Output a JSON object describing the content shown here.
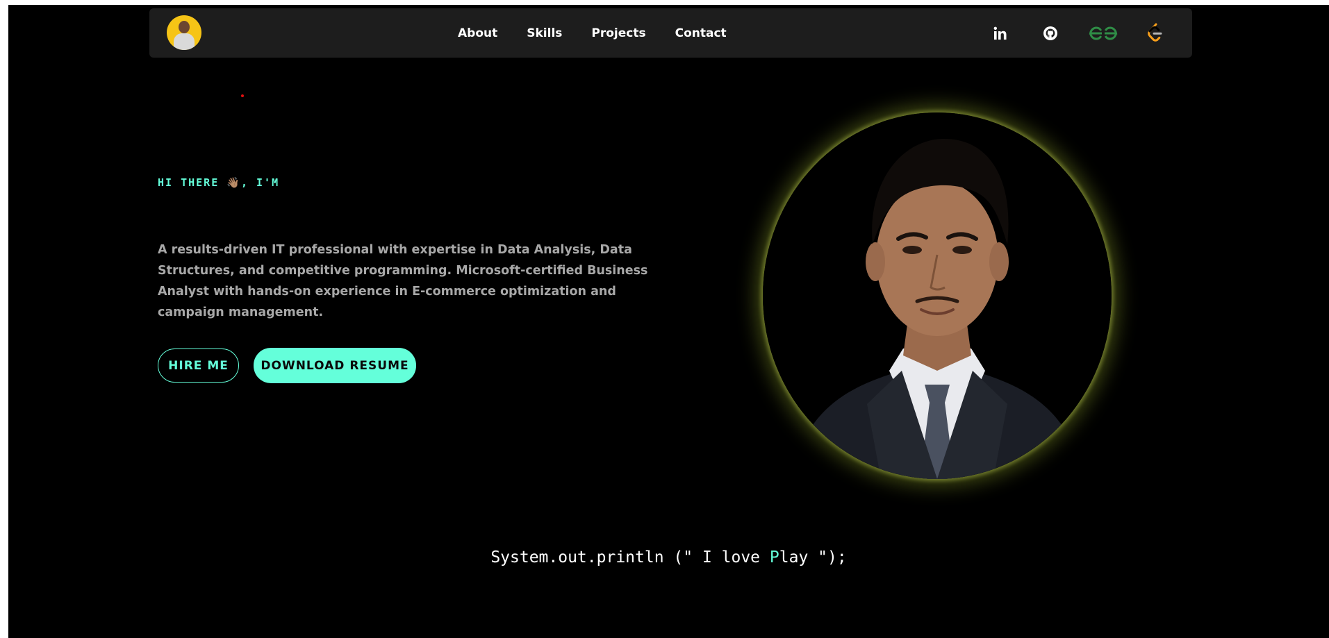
{
  "nav": {
    "links": [
      "About",
      "Skills",
      "Projects",
      "Contact"
    ],
    "socials": [
      "linkedin-icon",
      "github-icon",
      "geeksforgeeks-icon",
      "leetcode-icon"
    ]
  },
  "hero": {
    "greeting": "HI THERE 👋🏽, I'M",
    "bio": "A results-driven IT professional with expertise in Data Analysis, Data Structures, and competitive programming. Microsoft-certified Business Analyst with hands-on experience in E-commerce optimization and campaign management.",
    "hire_label": "HIRE ME",
    "resume_label": "DOWNLOAD RESUME"
  },
  "code": {
    "prefix": "System.out.println (\" I love ",
    "highlight": "P",
    "suffix": "lay \");"
  },
  "colors": {
    "accent": "#64ffda",
    "background": "#000000",
    "navbar": "#1d1d1d",
    "avatar_bg": "#f6c416",
    "glow": "#8ca028"
  }
}
